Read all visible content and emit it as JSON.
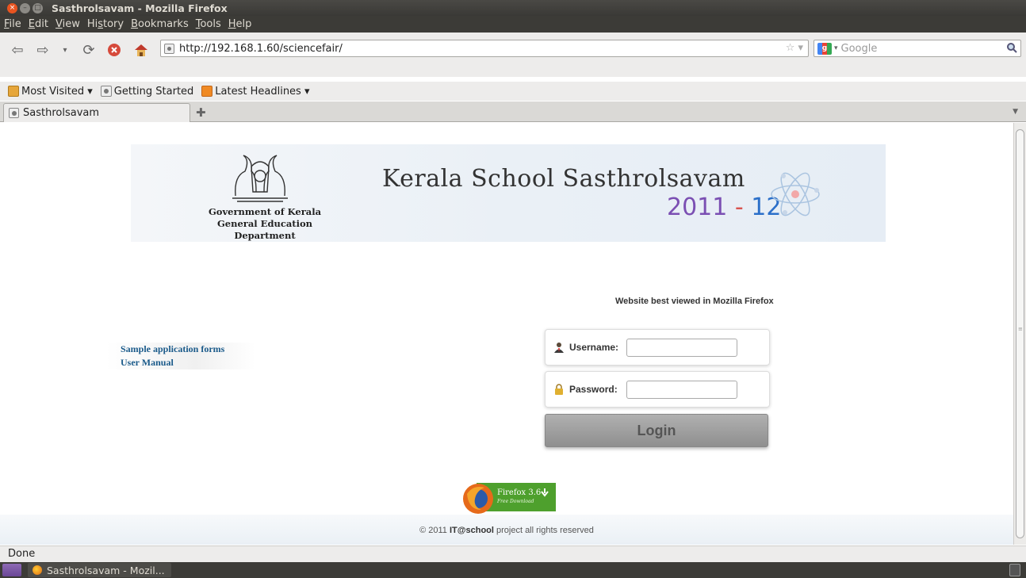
{
  "window": {
    "title": "Sasthrolsavam - Mozilla Firefox"
  },
  "menu": [
    "File",
    "Edit",
    "View",
    "History",
    "Bookmarks",
    "Tools",
    "Help"
  ],
  "menu_accel": [
    "F",
    "E",
    "V",
    "s",
    "B",
    "T",
    "H"
  ],
  "url": "http://192.168.1.60/sciencefair/",
  "search": {
    "placeholder": "Google"
  },
  "bookmarks": [
    {
      "label": "Most Visited ▾",
      "icon": "folder-icon"
    },
    {
      "label": "Getting Started",
      "icon": "page-icon"
    },
    {
      "label": "Latest Headlines ▾",
      "icon": "rss-icon"
    }
  ],
  "tab": {
    "label": "Sasthrolsavam"
  },
  "banner": {
    "govt_line1": "Government of Kerala",
    "govt_line2": "General Education Department",
    "title": "Kerala School Sasthrolsavam",
    "year_a": "2011",
    "year_sep": " - ",
    "year_b": "12"
  },
  "best_viewed": "Website best viewed in Mozilla Firefox",
  "links": [
    "Sample application forms",
    "User Manual"
  ],
  "login": {
    "username_label": "Username:",
    "password_label": "Password:",
    "username_value": "",
    "password_value": "",
    "button": "Login"
  },
  "ff_badge": {
    "name": "Firefox 3.6",
    "sub": "Free Download"
  },
  "footer": {
    "prefix": "© 2011 ",
    "brand": "IT@school",
    "suffix": " project all rights reserved"
  },
  "status": "Done",
  "taskbar": {
    "item": "Sasthrolsavam - Mozil..."
  },
  "colors": {
    "accent": "#e95420",
    "link": "#1a5a8a",
    "year_a": "#7b4fb3",
    "year_b": "#2b6fc9"
  }
}
